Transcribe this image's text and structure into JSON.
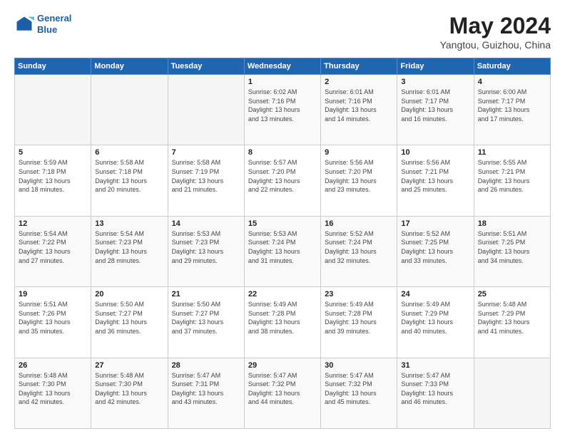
{
  "header": {
    "logo_line1": "General",
    "logo_line2": "Blue",
    "main_title": "May 2024",
    "sub_title": "Yangtou, Guizhou, China"
  },
  "weekdays": [
    "Sunday",
    "Monday",
    "Tuesday",
    "Wednesday",
    "Thursday",
    "Friday",
    "Saturday"
  ],
  "weeks": [
    [
      {
        "day": "",
        "info": ""
      },
      {
        "day": "",
        "info": ""
      },
      {
        "day": "",
        "info": ""
      },
      {
        "day": "1",
        "info": "Sunrise: 6:02 AM\nSunset: 7:16 PM\nDaylight: 13 hours\nand 13 minutes."
      },
      {
        "day": "2",
        "info": "Sunrise: 6:01 AM\nSunset: 7:16 PM\nDaylight: 13 hours\nand 14 minutes."
      },
      {
        "day": "3",
        "info": "Sunrise: 6:01 AM\nSunset: 7:17 PM\nDaylight: 13 hours\nand 16 minutes."
      },
      {
        "day": "4",
        "info": "Sunrise: 6:00 AM\nSunset: 7:17 PM\nDaylight: 13 hours\nand 17 minutes."
      }
    ],
    [
      {
        "day": "5",
        "info": "Sunrise: 5:59 AM\nSunset: 7:18 PM\nDaylight: 13 hours\nand 18 minutes."
      },
      {
        "day": "6",
        "info": "Sunrise: 5:58 AM\nSunset: 7:18 PM\nDaylight: 13 hours\nand 20 minutes."
      },
      {
        "day": "7",
        "info": "Sunrise: 5:58 AM\nSunset: 7:19 PM\nDaylight: 13 hours\nand 21 minutes."
      },
      {
        "day": "8",
        "info": "Sunrise: 5:57 AM\nSunset: 7:20 PM\nDaylight: 13 hours\nand 22 minutes."
      },
      {
        "day": "9",
        "info": "Sunrise: 5:56 AM\nSunset: 7:20 PM\nDaylight: 13 hours\nand 23 minutes."
      },
      {
        "day": "10",
        "info": "Sunrise: 5:56 AM\nSunset: 7:21 PM\nDaylight: 13 hours\nand 25 minutes."
      },
      {
        "day": "11",
        "info": "Sunrise: 5:55 AM\nSunset: 7:21 PM\nDaylight: 13 hours\nand 26 minutes."
      }
    ],
    [
      {
        "day": "12",
        "info": "Sunrise: 5:54 AM\nSunset: 7:22 PM\nDaylight: 13 hours\nand 27 minutes."
      },
      {
        "day": "13",
        "info": "Sunrise: 5:54 AM\nSunset: 7:23 PM\nDaylight: 13 hours\nand 28 minutes."
      },
      {
        "day": "14",
        "info": "Sunrise: 5:53 AM\nSunset: 7:23 PM\nDaylight: 13 hours\nand 29 minutes."
      },
      {
        "day": "15",
        "info": "Sunrise: 5:53 AM\nSunset: 7:24 PM\nDaylight: 13 hours\nand 31 minutes."
      },
      {
        "day": "16",
        "info": "Sunrise: 5:52 AM\nSunset: 7:24 PM\nDaylight: 13 hours\nand 32 minutes."
      },
      {
        "day": "17",
        "info": "Sunrise: 5:52 AM\nSunset: 7:25 PM\nDaylight: 13 hours\nand 33 minutes."
      },
      {
        "day": "18",
        "info": "Sunrise: 5:51 AM\nSunset: 7:25 PM\nDaylight: 13 hours\nand 34 minutes."
      }
    ],
    [
      {
        "day": "19",
        "info": "Sunrise: 5:51 AM\nSunset: 7:26 PM\nDaylight: 13 hours\nand 35 minutes."
      },
      {
        "day": "20",
        "info": "Sunrise: 5:50 AM\nSunset: 7:27 PM\nDaylight: 13 hours\nand 36 minutes."
      },
      {
        "day": "21",
        "info": "Sunrise: 5:50 AM\nSunset: 7:27 PM\nDaylight: 13 hours\nand 37 minutes."
      },
      {
        "day": "22",
        "info": "Sunrise: 5:49 AM\nSunset: 7:28 PM\nDaylight: 13 hours\nand 38 minutes."
      },
      {
        "day": "23",
        "info": "Sunrise: 5:49 AM\nSunset: 7:28 PM\nDaylight: 13 hours\nand 39 minutes."
      },
      {
        "day": "24",
        "info": "Sunrise: 5:49 AM\nSunset: 7:29 PM\nDaylight: 13 hours\nand 40 minutes."
      },
      {
        "day": "25",
        "info": "Sunrise: 5:48 AM\nSunset: 7:29 PM\nDaylight: 13 hours\nand 41 minutes."
      }
    ],
    [
      {
        "day": "26",
        "info": "Sunrise: 5:48 AM\nSunset: 7:30 PM\nDaylight: 13 hours\nand 42 minutes."
      },
      {
        "day": "27",
        "info": "Sunrise: 5:48 AM\nSunset: 7:30 PM\nDaylight: 13 hours\nand 42 minutes."
      },
      {
        "day": "28",
        "info": "Sunrise: 5:47 AM\nSunset: 7:31 PM\nDaylight: 13 hours\nand 43 minutes."
      },
      {
        "day": "29",
        "info": "Sunrise: 5:47 AM\nSunset: 7:32 PM\nDaylight: 13 hours\nand 44 minutes."
      },
      {
        "day": "30",
        "info": "Sunrise: 5:47 AM\nSunset: 7:32 PM\nDaylight: 13 hours\nand 45 minutes."
      },
      {
        "day": "31",
        "info": "Sunrise: 5:47 AM\nSunset: 7:33 PM\nDaylight: 13 hours\nand 46 minutes."
      },
      {
        "day": "",
        "info": ""
      }
    ]
  ]
}
